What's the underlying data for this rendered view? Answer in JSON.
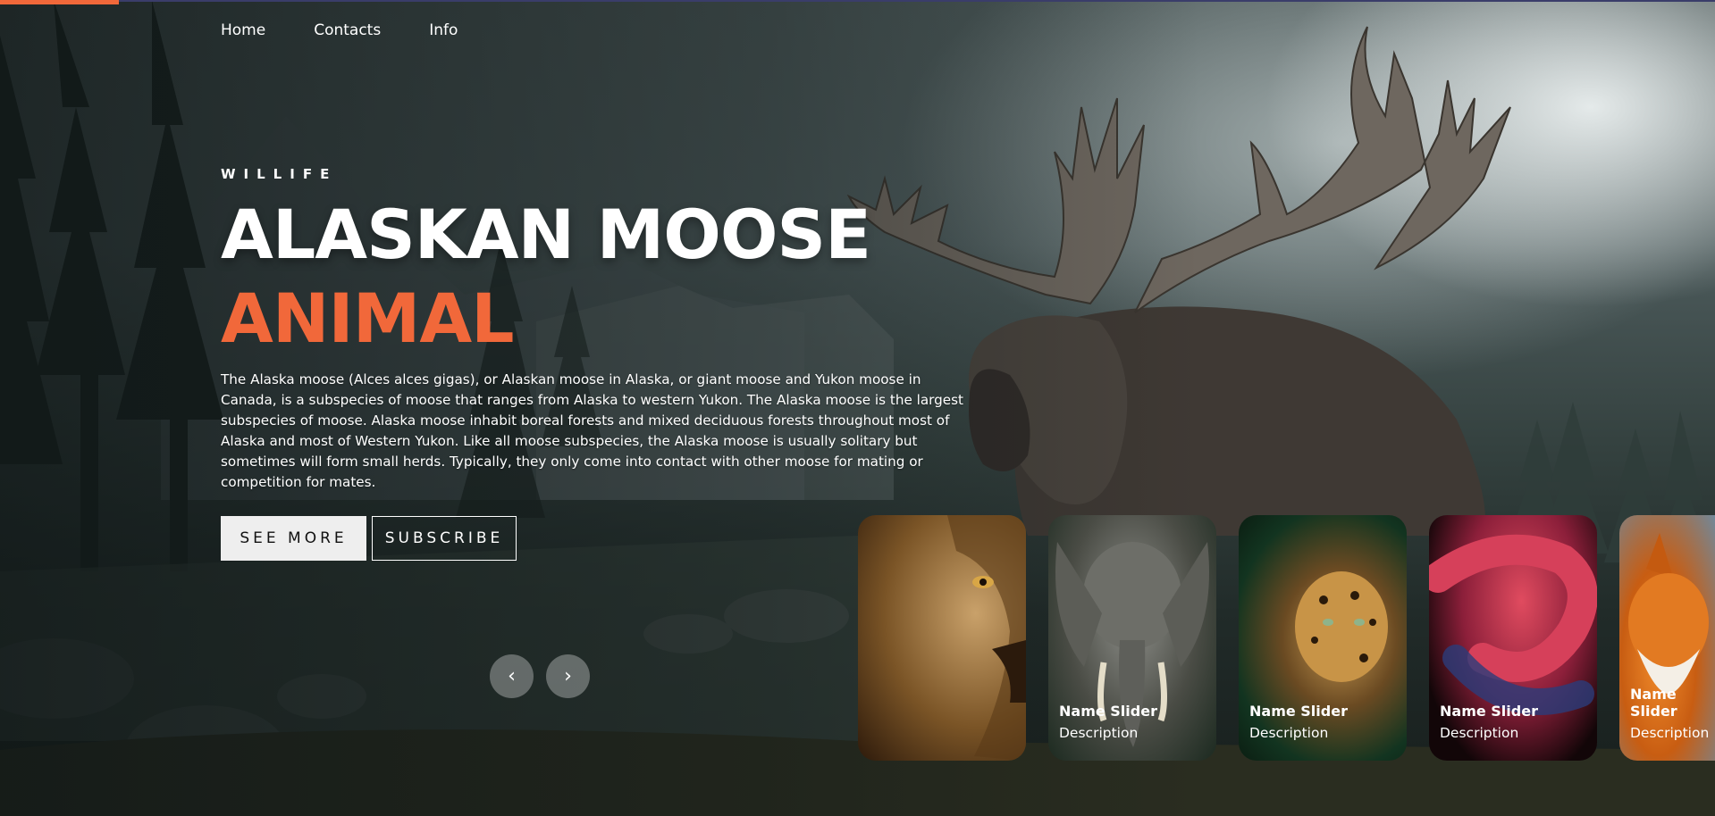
{
  "nav": {
    "home": "Home",
    "contacts": "Contacts",
    "info": "Info"
  },
  "hero": {
    "author": "WILLIFE",
    "title": "ALASKAN MOOSE",
    "topic": "ANIMAL",
    "description": "The Alaska moose (Alces alces gigas), or Alaskan moose in Alaska, or giant moose and Yukon moose in Canada, is a subspecies of moose that ranges from Alaska to western Yukon. The Alaska moose is the largest subspecies of moose. Alaska moose inhabit boreal forests and mixed deciduous forests throughout most of Alaska and most of Western Yukon. Like all moose subspecies, the Alaska moose is usually solitary but sometimes will form small herds. Typically, they only come into contact with other moose for mating or competition for mates.",
    "see_more": "SEE MORE",
    "subscribe": "SUBSCRIBE"
  },
  "controls": {
    "prev_icon": "chevron-left-icon",
    "prev": "‹",
    "next_icon": "chevron-right-icon",
    "next": "›"
  },
  "thumbnails": [
    {
      "animal": "lion",
      "name": "",
      "description": ""
    },
    {
      "animal": "elephant",
      "name": "Name Slider",
      "description": "Description"
    },
    {
      "animal": "leopard",
      "name": "Name Slider",
      "description": "Description"
    },
    {
      "animal": "snake",
      "name": "Name Slider",
      "description": "Description"
    },
    {
      "animal": "fox",
      "name": "Name Slider",
      "description": "Description"
    }
  ],
  "colors": {
    "accent": "#f1683a",
    "button_light": "#eeeeee"
  }
}
